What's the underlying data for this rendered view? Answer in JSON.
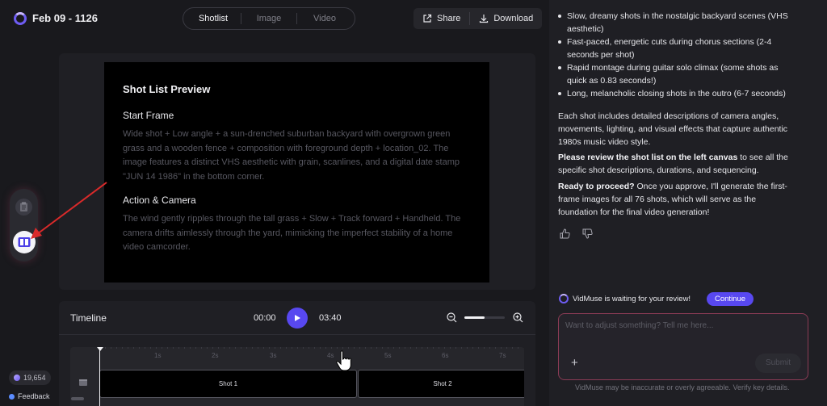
{
  "header": {
    "project_title": "Feb 09 - 1126",
    "tabs": [
      "Shotlist",
      "Image",
      "Video"
    ],
    "active_tab": "Shotlist",
    "share_label": "Share",
    "download_label": "Download"
  },
  "preview": {
    "title": "Shot List Preview",
    "start_frame_heading": "Start Frame",
    "start_frame_text": "Wide shot + Low angle + a sun-drenched suburban backyard with overgrown green grass and a wooden fence + composition with foreground depth + location_02. The image features a distinct VHS aesthetic with grain, scanlines, and a digital date stamp \"JUN 14 1986\" in the bottom corner.",
    "action_heading": "Action & Camera",
    "action_text": "The wind gently ripples through the tall grass + Slow + Track forward + Handheld. The camera drifts aimlessly through the yard, mimicking the imperfect stability of a home video camcorder."
  },
  "sidebar": {
    "credits": "19,654",
    "feedback_label": "Feedback"
  },
  "timeline": {
    "title": "Timeline",
    "current_time": "00:00",
    "total_time": "03:40",
    "zoom_level": 0.5,
    "ticks": [
      "1s",
      "2s",
      "3s",
      "4s",
      "5s",
      "6s",
      "7s"
    ],
    "shots": [
      "Shot 1",
      "Shot 2"
    ]
  },
  "chat": {
    "bullets": [
      "Slow, dreamy shots in the nostalgic backyard scenes (VHS aesthetic)",
      "Fast-paced, energetic cuts during chorus sections (2-4 seconds per shot)",
      "Rapid montage during guitar solo climax (some shots as quick as 0.83 seconds!)",
      "Long, melancholic closing shots in the outro (6-7 seconds)"
    ],
    "paragraph1": "Each shot includes detailed descriptions of camera angles, movements, lighting, and visual effects that capture authentic 1980s music video style.",
    "paragraph2_bold": "Please review the shot list on the left canvas",
    "paragraph2_rest": " to see all the specific shot descriptions, durations, and sequencing.",
    "paragraph3_bold": "Ready to proceed?",
    "paragraph3_rest": " Once you approve, I'll generate the first-frame images for all 76 shots, which will serve as the foundation for the final video generation!",
    "waiting_text": "VidMuse is waiting for your review!",
    "continue_label": "Continue",
    "input_placeholder": "Want to adjust something? Tell me here...",
    "submit_label": "Submit",
    "disclaimer": "VidMuse may be inaccurate or overly agreeable. Verify key details."
  }
}
